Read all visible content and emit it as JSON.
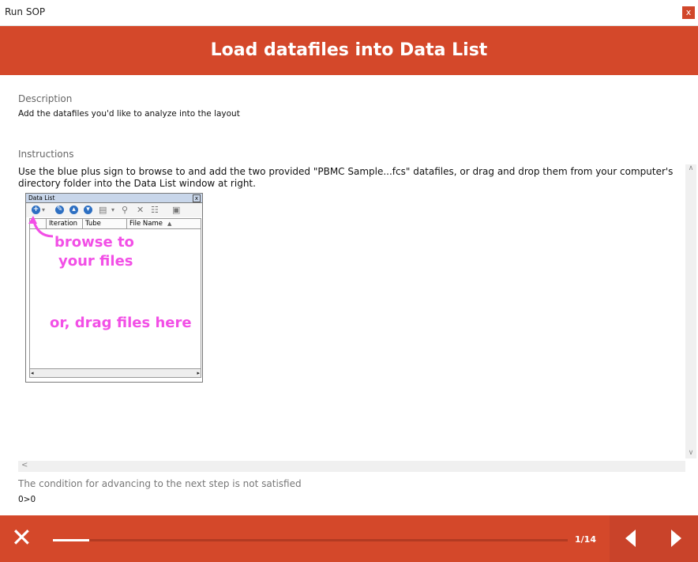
{
  "window": {
    "title": "Run SOP",
    "close_label": "x"
  },
  "header": {
    "title": "Load datafiles into Data List"
  },
  "description": {
    "label": "Description",
    "text": "Add the datafiles you'd like to analyze into the layout"
  },
  "instructions": {
    "label": "Instructions",
    "text": "Use the blue plus sign to browse to and add the two provided \"PBMC Sample...fcs\" datafiles, or drag and drop them from your computer's directory folder into the Data List window at right.",
    "figure": {
      "window_title": "Data List",
      "close_glyph": "x",
      "columns": [
        "Iteration",
        "Tube",
        "File Name"
      ],
      "sort_glyph": "▲",
      "annotation_browse_line1": "browse to",
      "annotation_browse_line2": "your files",
      "annotation_drag": "or, drag files here",
      "scroll_left_glyph": "◂",
      "scroll_right_glyph": "▸",
      "annotation_color": "#f24fe6"
    }
  },
  "scroll": {
    "up_glyph": "∧",
    "down_glyph": "∨",
    "left_glyph": "<"
  },
  "condition": {
    "text": "The condition for advancing to the next step is not satisfied",
    "value": "0>0"
  },
  "footer": {
    "close_glyph": "✕",
    "page": "1/14",
    "progress_fraction": 0.07
  },
  "colors": {
    "accent": "#d4482a",
    "accent_dark": "#c9432a"
  }
}
